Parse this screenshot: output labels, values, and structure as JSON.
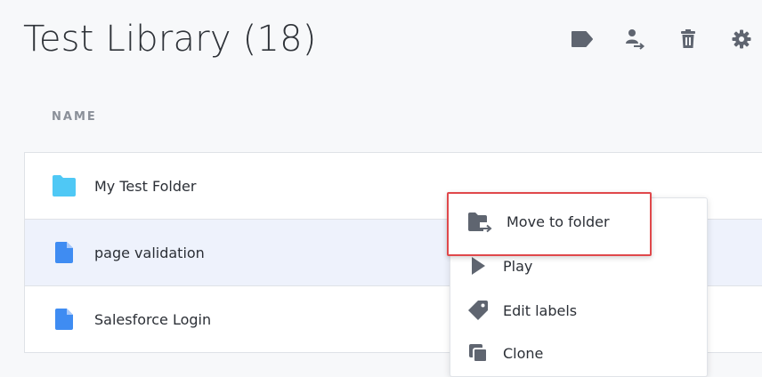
{
  "page": {
    "title": "Test Library (18)"
  },
  "toolbar": {
    "icons": [
      "label-icon",
      "move-user-icon",
      "trash-icon",
      "gear-icon"
    ]
  },
  "table": {
    "column_header": "NAME",
    "rows": [
      {
        "label": "My Test Folder",
        "icon": "folder-icon",
        "color": "#4fc8f5"
      },
      {
        "label": "page validation",
        "icon": "file-icon",
        "color": "#3f8cf2"
      },
      {
        "label": "Salesforce Login",
        "icon": "file-icon",
        "color": "#3f8cf2"
      }
    ]
  },
  "context_menu": {
    "items": [
      {
        "label": "Move to folder",
        "icon": "folder-move-icon"
      },
      {
        "label": "Play",
        "icon": "play-icon"
      },
      {
        "label": "Edit labels",
        "icon": "tag-icon"
      },
      {
        "label": "Clone",
        "icon": "clone-icon"
      }
    ]
  },
  "colors": {
    "icon_gray": "#5f6570",
    "highlight": "#e0484b",
    "selected_row": "#eef2fc"
  }
}
